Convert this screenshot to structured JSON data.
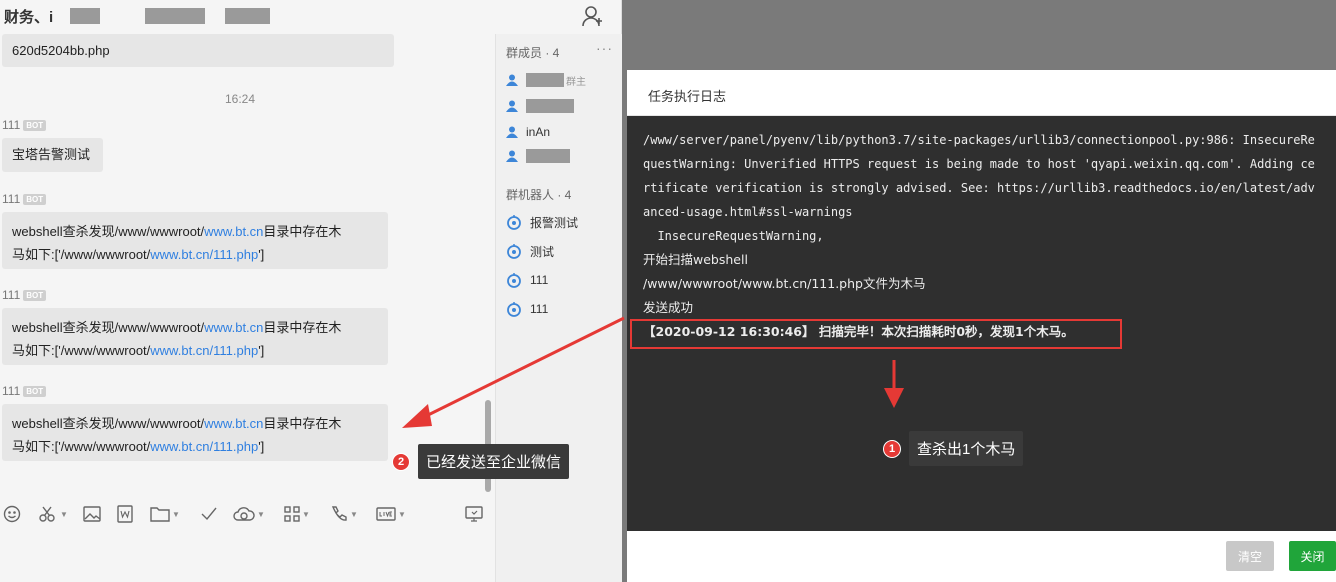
{
  "chat": {
    "title": "财务、i",
    "messages": [
      {
        "type": "bubble",
        "text": "620d5204bb.php"
      },
      {
        "type": "time",
        "text": "16:24"
      },
      {
        "type": "sender",
        "name": "111",
        "badge": "BOT"
      },
      {
        "type": "bubble",
        "text": "宝塔告警测试"
      },
      {
        "type": "sender",
        "name": "111",
        "badge": "BOT"
      },
      {
        "type": "webshell",
        "pre": "webshell查杀发现/www/wwwroot/",
        "link": "www.bt.cn",
        "mid": "目录中存在木",
        "line2pre": "马如下:['/www/wwwroot/",
        "link2": "www.bt.cn/111.php",
        "line2post": "']"
      },
      {
        "type": "sender",
        "name": "111",
        "badge": "BOT"
      },
      {
        "type": "webshell",
        "pre": "webshell查杀发现/www/wwwroot/",
        "link": "www.bt.cn",
        "mid": "目录中存在木",
        "line2pre": "马如下:['/www/wwwroot/",
        "link2": "www.bt.cn/111.php",
        "line2post": "']"
      },
      {
        "type": "sender",
        "name": "111",
        "badge": "BOT"
      },
      {
        "type": "webshell",
        "pre": "webshell查杀发现/www/wwwroot/",
        "link": "www.bt.cn",
        "mid": "目录中存在木",
        "line2pre": "马如下:['/www/wwwroot/",
        "link2": "www.bt.cn/111.php",
        "line2post": "']"
      }
    ],
    "toolbar_icons": [
      "emoji-icon",
      "scissors-icon",
      "image-icon",
      "word-icon",
      "folder-icon",
      "check-icon",
      "cloud-icon",
      "apps-icon",
      "phone-icon",
      "live-icon",
      "screen-icon"
    ]
  },
  "members": {
    "header": "群成员 · 4",
    "more": "···",
    "owner_suffix": "群主",
    "visible_member": "inAn",
    "robots_header": "群机器人 · 4",
    "robots": [
      "报警测试",
      "测试",
      "111",
      "111"
    ]
  },
  "annotations": {
    "one": {
      "num": "1",
      "text": "查杀出1个木马"
    },
    "two": {
      "num": "2",
      "text": "已经发送至企业微信"
    }
  },
  "dialog": {
    "title": "任务执行日志",
    "log_lines": [
      "/www/server/panel/pyenv/lib/python3.7/site-packages/urllib3/connectionpool.py:986: InsecureRe",
      "questWarning: Unverified HTTPS request is being made to host 'qyapi.weixin.qq.com'. Adding ce",
      "rtificate verification is strongly advised. See: https://urllib3.readthedocs.io/en/latest/adv",
      "anced-usage.html#ssl-warnings",
      "  InsecureRequestWarning,",
      "开始扫描webshell",
      "/www/wwwroot/www.bt.cn/111.php文件为木马",
      "发送成功",
      "【2020-09-12 16:30:46】 扫描完毕！本次扫描耗时0秒，发现1个木马。"
    ],
    "btn_clear": "清空",
    "btn_close": "关闭"
  },
  "colors": {
    "accent_red": "#e53935",
    "close_green": "#20a53a",
    "link_blue": "#2f7fe0",
    "log_bg": "#2f2f2f"
  }
}
